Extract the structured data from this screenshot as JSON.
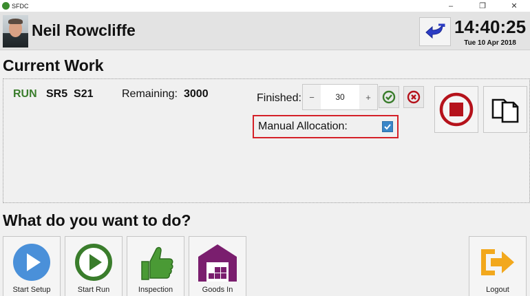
{
  "window": {
    "title": "SFDC",
    "controls": [
      "–",
      "❐",
      "✕"
    ]
  },
  "header": {
    "user_name": "Neil Rowcliffe",
    "time": "14:40:25",
    "date": "Tue 10 Apr 2018",
    "back_icon": "back-arrow-icon"
  },
  "current_work": {
    "title": "Current Work",
    "run_status": "RUN",
    "run_code": "SR5  S21",
    "remaining_label": "Remaining:",
    "remaining_value": "3000",
    "finished_label": "Finished:",
    "finished_value": "30",
    "stepper_minus": "−",
    "stepper_plus": "+",
    "manual_allocation_label": "Manual Allocation:",
    "manual_allocation_checked": true
  },
  "actions": {
    "title": "What do you want to do?",
    "tiles": [
      {
        "label": "Start Setup",
        "icon": "play-blue-icon",
        "color": "#4a90d9"
      },
      {
        "label": "Start Run",
        "icon": "play-green-icon",
        "color": "#3a7d2c"
      },
      {
        "label": "Inspection",
        "icon": "thumbs-up-icon",
        "color": "#4a9a35"
      },
      {
        "label": "Goods In",
        "icon": "warehouse-icon",
        "color": "#7a1e6e"
      },
      {
        "label": "Logout",
        "icon": "logout-arrow-icon",
        "color": "#f2a81d"
      }
    ]
  },
  "colors": {
    "accent_green": "#3a7d2c",
    "highlight_red": "#d42027",
    "stop_red": "#b5121b",
    "back_blue": "#2b3cc4"
  }
}
